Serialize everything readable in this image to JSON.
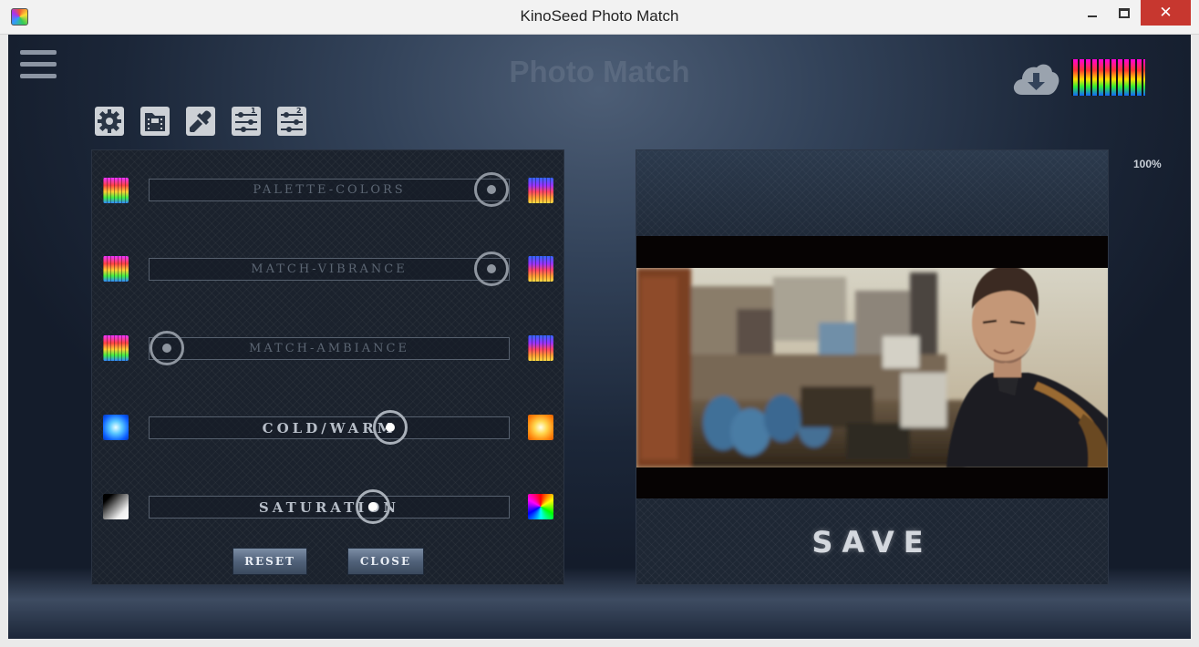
{
  "window": {
    "title": "KinoSeed Photo Match",
    "close_glyph": "✕",
    "icons": [
      "kinoseed-app-icon",
      "minimize-icon",
      "maximize-icon",
      "close-icon"
    ]
  },
  "header": {
    "title": "Photo Match",
    "icons": [
      "hamburger-menu-icon",
      "cloud-download-icon",
      "palette-thumbnail"
    ]
  },
  "toolbar": {
    "icons": [
      "gear-icon",
      "film-folder-icon",
      "eyedropper-icon",
      "sliders-1-icon",
      "sliders-2-icon"
    ]
  },
  "sliders": [
    {
      "label": "PALETTE-COLORS",
      "value_pct": 95,
      "emphasis": false,
      "left_swatch": "palette-swatch",
      "right_swatch": "palette-swatch-alt"
    },
    {
      "label": "MATCH-VIBRANCE",
      "value_pct": 95,
      "emphasis": false,
      "left_swatch": "palette-swatch",
      "right_swatch": "palette-swatch-alt"
    },
    {
      "label": "MATCH-AMBIANCE",
      "value_pct": 5,
      "emphasis": false,
      "left_swatch": "palette-swatch",
      "right_swatch": "palette-swatch-alt"
    },
    {
      "label": "COLD/WARM",
      "value_pct": 67,
      "emphasis": true,
      "left_swatch": "cold-swatch",
      "right_swatch": "warm-swatch"
    },
    {
      "label": "SATURATION",
      "value_pct": 62,
      "emphasis": true,
      "left_swatch": "grayscale-swatch",
      "right_swatch": "color-wheel-swatch"
    }
  ],
  "buttons": {
    "reset": "RESET",
    "close": "CLOSE",
    "save": "SAVE"
  },
  "zoom_label": "100%"
}
